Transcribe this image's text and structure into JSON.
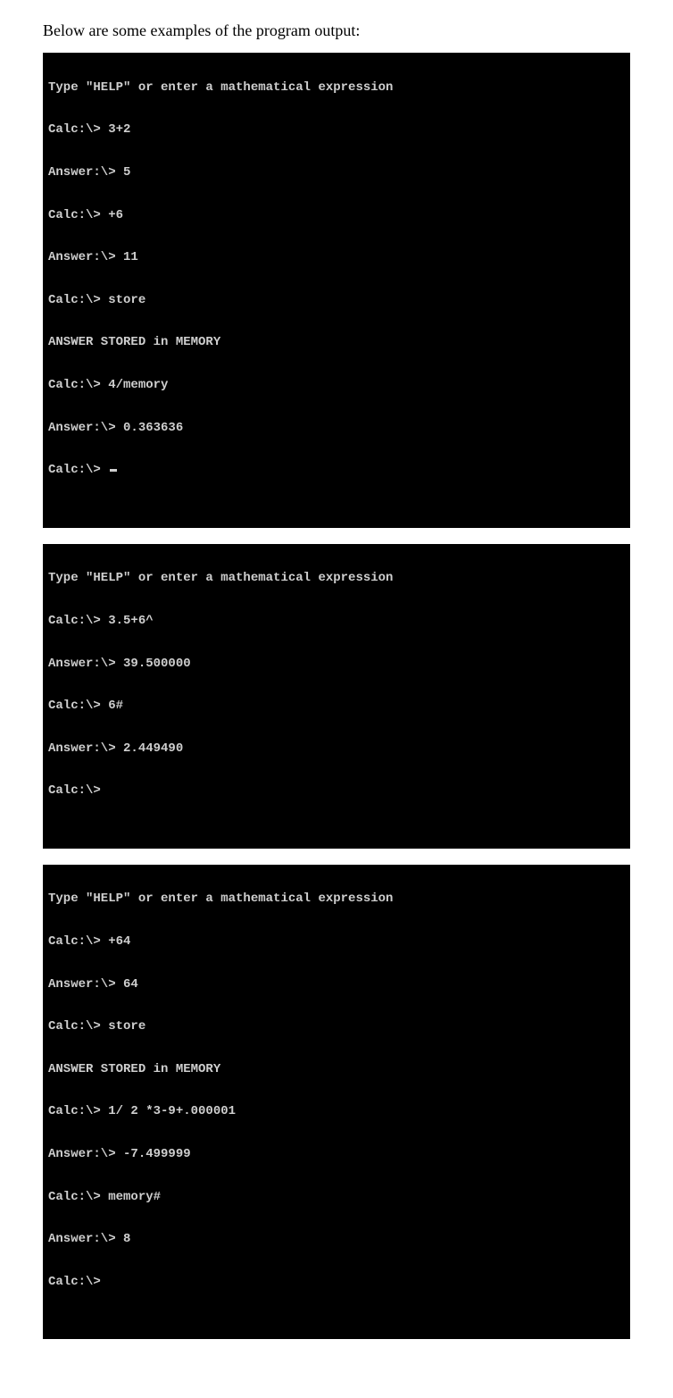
{
  "intro": "Below are some examples of the program output:",
  "term1": {
    "l1": "Type \"HELP\" or enter a mathematical expression",
    "l2": "Calc:\\> 3+2",
    "l3": "Answer:\\> 5",
    "l4": "Calc:\\> +6",
    "l5": "Answer:\\> 11",
    "l6": "Calc:\\> store",
    "l7": "ANSWER STORED in MEMORY",
    "l8": "Calc:\\> 4/memory",
    "l9": "Answer:\\> 0.363636",
    "l10": "Calc:\\> "
  },
  "term2": {
    "l1": "Type \"HELP\" or enter a mathematical expression",
    "l2": "Calc:\\> 3.5+6^",
    "l3": "Answer:\\> 39.500000",
    "l4": "Calc:\\> 6#",
    "l5": "Answer:\\> 2.449490",
    "l6": "Calc:\\>"
  },
  "term3": {
    "l1": "Type \"HELP\" or enter a mathematical expression",
    "l2": "Calc:\\> +64",
    "l3": "Answer:\\> 64",
    "l4": "Calc:\\> store",
    "l5": "ANSWER STORED in MEMORY",
    "l6": "Calc:\\> 1/ 2 *3-9+.000001",
    "l7": "Answer:\\> -7.499999",
    "l8": "Calc:\\> memory#",
    "l9": "Answer:\\> 8",
    "l10": "Calc:\\>"
  }
}
